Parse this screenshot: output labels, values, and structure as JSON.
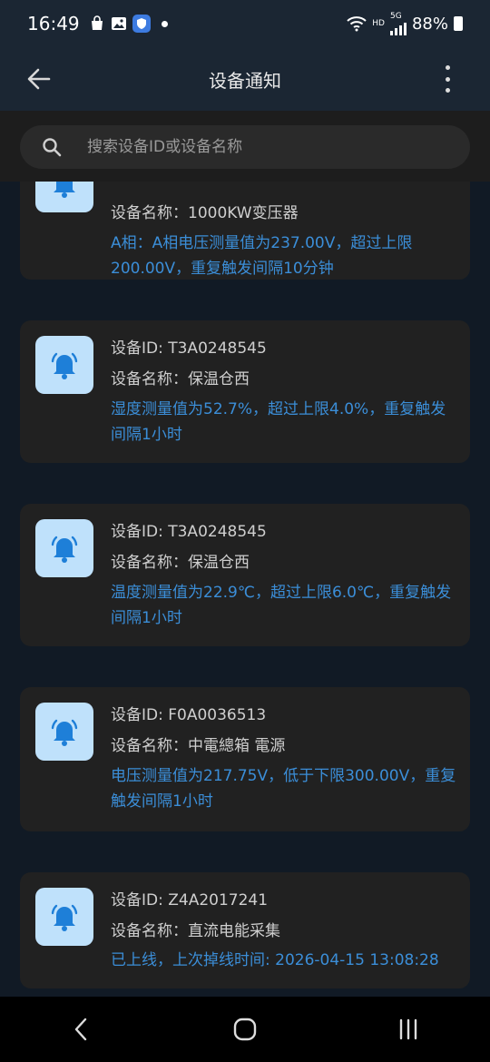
{
  "status_bar": {
    "time": "16:49",
    "battery": "88%",
    "hd_label": "HD",
    "network_label": "5G",
    "icons": [
      "shopping-bag-icon",
      "gallery-icon",
      "security-app-icon",
      "notification-dot-icon",
      "wifi-icon",
      "signal-icon",
      "battery-icon"
    ]
  },
  "app_bar": {
    "title": "设备通知",
    "back_icon": "arrow-left-icon",
    "menu_icon": "more-vertical-icon"
  },
  "search": {
    "placeholder": "搜索设备ID或设备名称",
    "icon": "search-icon"
  },
  "notifications": [
    {
      "id_label": "",
      "name_label": "设备名称：1000KW变压器",
      "message": "A相：A相电压测量值为237.00V，超过上限200.00V，重复触发间隔10分钟"
    },
    {
      "id_label": "设备ID: T3A0248545",
      "name_label": "设备名称：保温仓西",
      "message": "湿度测量值为52.7%，超过上限4.0%，重复触发间隔1小时"
    },
    {
      "id_label": "设备ID: T3A0248545",
      "name_label": "设备名称：保温仓西",
      "message": "温度测量值为22.9℃，超过上限6.0℃，重复触发间隔1小时"
    },
    {
      "id_label": "设备ID: F0A0036513",
      "name_label": "设备名称：中電總箱 電源",
      "message": "电压测量值为217.75V，低于下限300.00V，重复触发间隔1小时"
    },
    {
      "id_label": "设备ID: Z4A2017241",
      "name_label": "设备名称：直流电能采集",
      "message": "已上线，上次掉线时间: 2026-04-15 13:08:28"
    }
  ],
  "colors": {
    "background": "#111a25",
    "card": "#212121",
    "accent_text": "#3b8ed8",
    "bell_tile": "#bfe1fb",
    "bell": "#1e7fd8"
  },
  "nav_bar": {
    "icons": [
      "nav-back-icon",
      "nav-home-icon",
      "nav-recents-icon"
    ]
  }
}
